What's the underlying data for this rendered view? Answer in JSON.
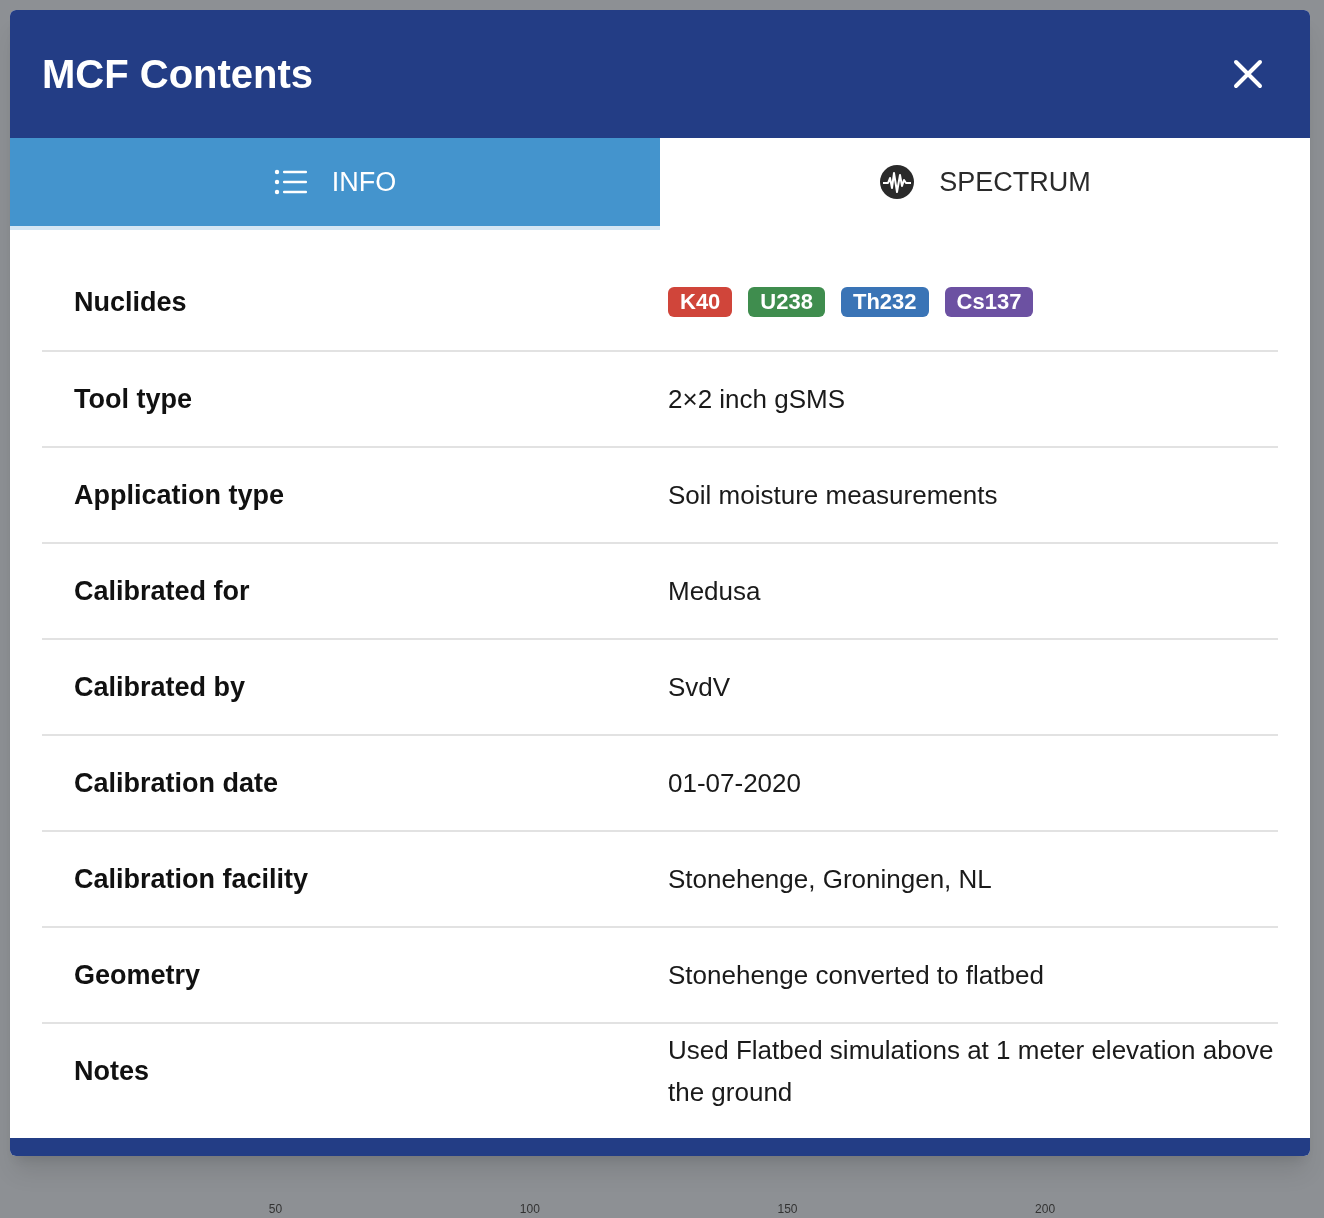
{
  "background": {
    "x_ticks": [
      "50",
      "100",
      "150",
      "200"
    ]
  },
  "dialog": {
    "title": "MCF Contents",
    "tabs": [
      {
        "label": "INFO",
        "selected": true
      },
      {
        "label": "SPECTRUM",
        "selected": false
      }
    ],
    "rows": [
      {
        "kind": "tags",
        "label": "Nuclides",
        "tags": [
          {
            "text": "K40",
            "color": "#d0453a"
          },
          {
            "text": "U238",
            "color": "#3f8d4e"
          },
          {
            "text": "Th232",
            "color": "#3a74b6"
          },
          {
            "text": "Cs137",
            "color": "#6c51a2"
          }
        ]
      },
      {
        "kind": "text",
        "label": "Tool type",
        "value": "2×2 inch gSMS"
      },
      {
        "kind": "text",
        "label": "Application type",
        "value": "Soil moisture measurements"
      },
      {
        "kind": "text",
        "label": "Calibrated for",
        "value": "Medusa"
      },
      {
        "kind": "text",
        "label": "Calibrated by",
        "value": "SvdV"
      },
      {
        "kind": "text",
        "label": "Calibration date",
        "value": "01-07-2020"
      },
      {
        "kind": "text",
        "label": "Calibration facility",
        "value": "Stonehenge, Groningen, NL"
      },
      {
        "kind": "text",
        "label": "Geometry",
        "value": "Stonehenge converted to flatbed"
      },
      {
        "kind": "text",
        "label": "Notes",
        "value": "Used Flatbed simulations at 1 meter elevation above the ground"
      }
    ]
  }
}
